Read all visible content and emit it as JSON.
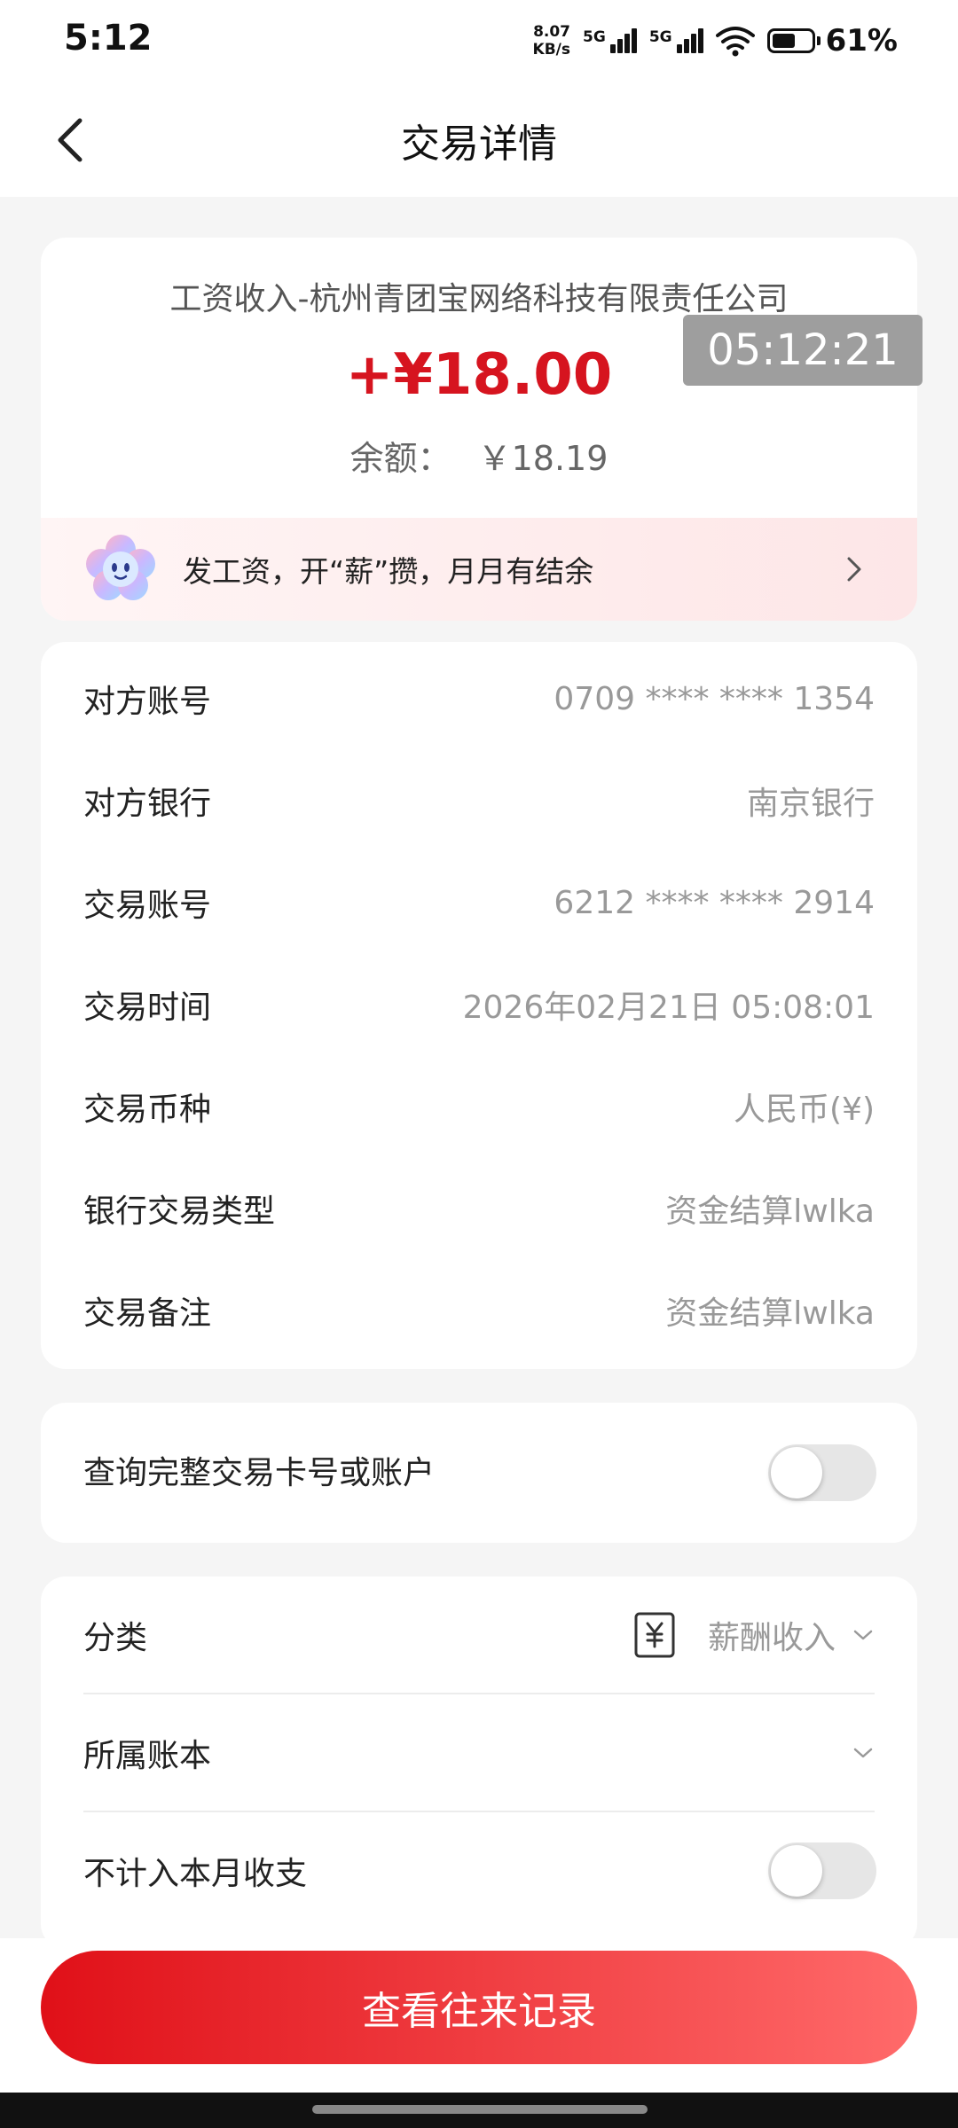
{
  "status_bar": {
    "time": "5:12",
    "net_speed_value": "8.07",
    "net_speed_unit": "KB/s",
    "sim1_label": "5G",
    "sim2_label": "5G",
    "battery_percent": "61%",
    "battery_level": 0.61
  },
  "nav": {
    "title": "交易详情",
    "back_icon": "chevron-left-icon"
  },
  "transaction": {
    "description": "工资收入-杭州青团宝网络科技有限责任公司",
    "amount": "+¥18.00",
    "balance_label": "余额：",
    "balance_value": "￥18.19",
    "amount_color": "#d6141f"
  },
  "overlay_timestamp": "05:12:21",
  "promo": {
    "text": "发工资，开“薪”攒，月月有结余",
    "icon": "flower-mascot-icon"
  },
  "details": [
    {
      "key": "对方账号",
      "value": "0709 **** **** 1354"
    },
    {
      "key": "对方银行",
      "value": "南京银行"
    },
    {
      "key": "交易账号",
      "value": "6212 **** **** 2914"
    },
    {
      "key": "交易时间",
      "value": "2026年02月21日 05:08:01"
    },
    {
      "key": "交易币种",
      "value": "人民币(¥)"
    },
    {
      "key": "银行交易类型",
      "value": "资金结算lwlka"
    },
    {
      "key": "交易备注",
      "value": "资金结算lwlka"
    }
  ],
  "query_full": {
    "label": "查询完整交易卡号或账户",
    "enabled": false
  },
  "category": {
    "label": "分类",
    "value": "薪酬收入",
    "icon": "yuan-receipt-icon"
  },
  "ledger": {
    "label": "所属账本",
    "value": ""
  },
  "exclude_month": {
    "label": "不计入本月收支",
    "enabled": false
  },
  "cta": {
    "label": "查看往来记录"
  },
  "colors": {
    "accent_red": "#e01018",
    "accent_red_light": "#ff6a6a",
    "page_bg": "#f5f5f5"
  }
}
